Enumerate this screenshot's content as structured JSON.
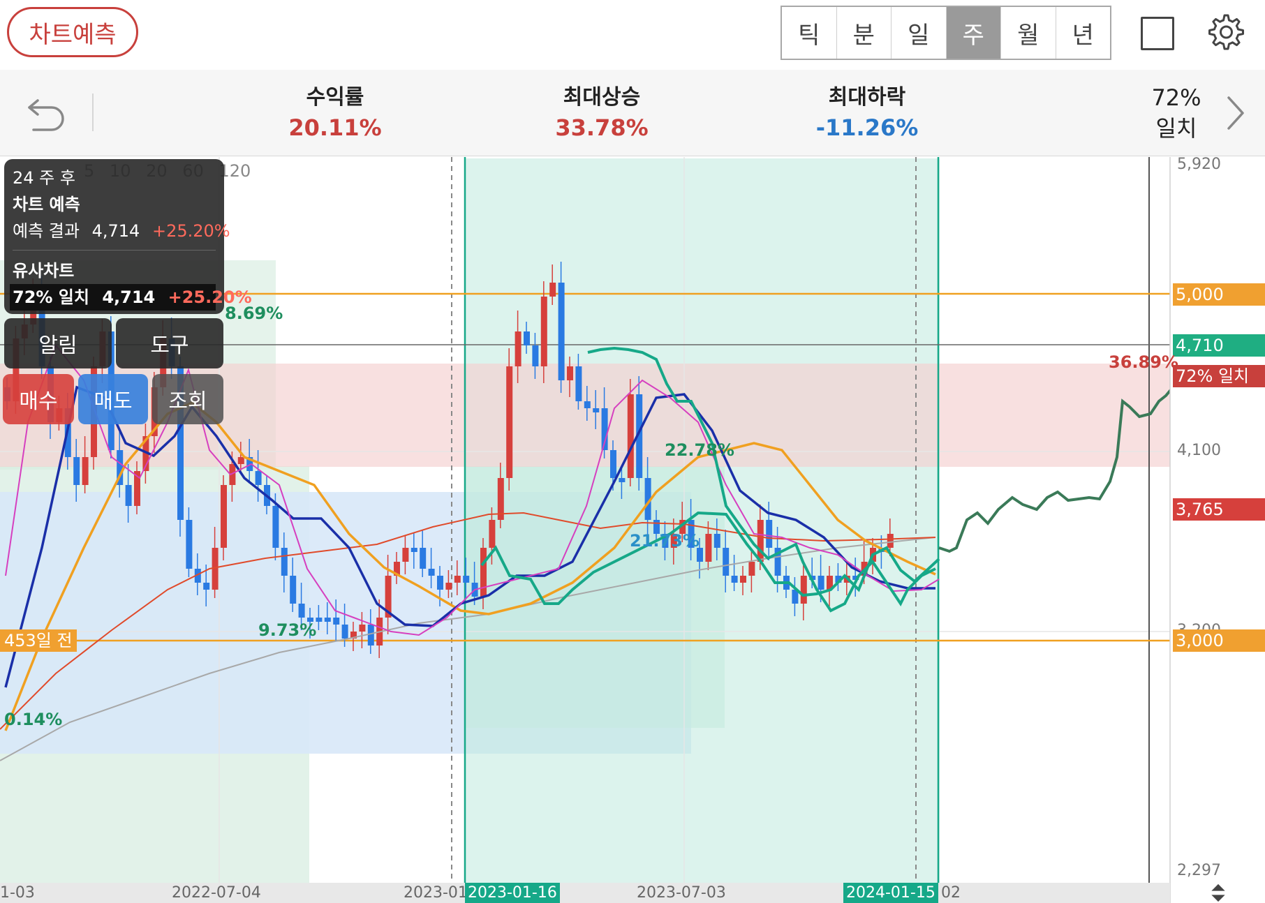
{
  "toolbar": {
    "predict_button": "차트예측",
    "period_tabs": [
      "틱",
      "분",
      "일",
      "주",
      "월",
      "년"
    ],
    "active_period": "주"
  },
  "stats": {
    "return_label": "수익률",
    "return_value": "20.11%",
    "max_up_label": "최대상승",
    "max_up_value": "33.78%",
    "max_down_label": "최대하락",
    "max_down_value": "-11.26%",
    "match_value": "72%",
    "match_label": "일치"
  },
  "info_panel": {
    "horizon": "24 주 후",
    "title": "차트 예측",
    "result_label": "예측 결과",
    "result_price": "4,714",
    "result_change": "+25.20%",
    "similar_title": "유사차트",
    "similar_label": "72% 일치",
    "similar_price": "4,714",
    "similar_change": "+25.20%"
  },
  "buttons": {
    "alarm": "알림",
    "tool": "도구",
    "buy": "매수",
    "sell": "매도",
    "query": "조회"
  },
  "chart": {
    "ma_periods": [
      "5",
      "10",
      "20",
      "60",
      "120"
    ],
    "price_ticks": [
      "5,920",
      "4,100",
      "3,200",
      "2,297"
    ],
    "price_tags": {
      "line_5000": "5,000",
      "current": "4,710",
      "match_tag": "72% 일치",
      "base": "3,765",
      "line_3000": "3,000"
    },
    "date_ticks": [
      "1-03",
      "2022-07-04",
      "2023-01",
      "2023-07-03",
      "2024-01-15",
      "02"
    ],
    "range_labels": [
      "2023-01-16",
      "2024-01-15"
    ],
    "days_ago_tag": "453일 전",
    "pct_labels": {
      "a": "8.69%",
      "b": "9.73%",
      "c": "22.78%",
      "d": "21.73%",
      "e": "0.14%",
      "f": "36.89%"
    },
    "colors": {
      "up": "#d6403c",
      "down": "#2a7ae2",
      "ma5": "#d63fbf",
      "ma10": "#1a2fa8",
      "ma20": "#f0a020",
      "ma60": "#e04a2a",
      "ma120": "#a8a8a8",
      "similar": "#16a888",
      "forecast": "#3a7a58"
    }
  }
}
